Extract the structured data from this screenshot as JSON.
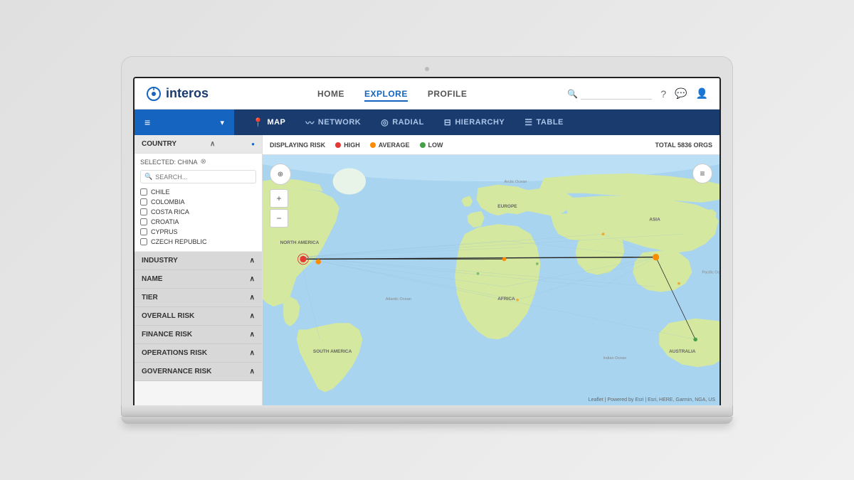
{
  "app": {
    "name": "interos"
  },
  "topnav": {
    "logo_text": "interos",
    "links": [
      {
        "label": "HOME",
        "active": false
      },
      {
        "label": "EXPLORE",
        "active": true
      },
      {
        "label": "PROFILE",
        "active": false
      }
    ],
    "search_placeholder": "",
    "icons": [
      "search",
      "help",
      "chat",
      "user"
    ]
  },
  "secondnav": {
    "filter_label": "",
    "tabs": [
      {
        "label": "MAP",
        "icon": "📍",
        "active": true
      },
      {
        "label": "NETWORK",
        "icon": "〰",
        "active": false
      },
      {
        "label": "RADIAL",
        "icon": "◎",
        "active": false
      },
      {
        "label": "HIERARCHY",
        "icon": "⊟",
        "active": false
      },
      {
        "label": "TABLE",
        "icon": "☰",
        "active": false
      }
    ]
  },
  "map": {
    "displaying_risk_label": "DISPLAYING RISK",
    "high_label": "HIGH",
    "average_label": "AVERAGE",
    "low_label": "LOW",
    "total_orgs_label": "TOTAL 5836 ORGS",
    "attribution": "Leaflet | Powered by Esri | Esri, HERE, Garmin, NGA, US"
  },
  "sidebar": {
    "country_header": "COUNTRY",
    "selected_label": "SELECTED: CHINA",
    "search_placeholder": "SEARCH...",
    "countries": [
      {
        "name": "CHILE"
      },
      {
        "name": "COLOMBIA"
      },
      {
        "name": "COSTA RICA"
      },
      {
        "name": "CROATIA"
      },
      {
        "name": "CYPRUS"
      },
      {
        "name": "CZECH REPUBLIC"
      }
    ],
    "filter_rows": [
      {
        "label": "INDUSTRY",
        "icon": "^"
      },
      {
        "label": "NAME",
        "icon": "^"
      },
      {
        "label": "TIER",
        "icon": "^"
      },
      {
        "label": "OVERALL RISK",
        "icon": "^"
      },
      {
        "label": "FINANCE RISK",
        "icon": "^"
      },
      {
        "label": "OPERATIONS RISK",
        "icon": "^"
      },
      {
        "label": "GOVERNANCE RISK",
        "icon": "^"
      }
    ]
  }
}
